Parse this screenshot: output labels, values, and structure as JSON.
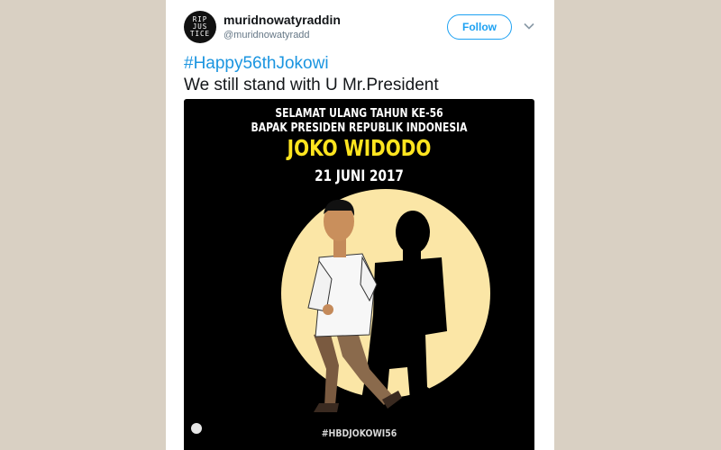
{
  "user": {
    "avatar_text": "RIP\nJUS\nTICE",
    "display_name": "muridnowatyraddin",
    "handle": "@muridnowatyradd"
  },
  "follow_label": "Follow",
  "tweet": {
    "hashtag": "#Happy56thJokowi",
    "text": "We still stand with U Mr.President"
  },
  "poster": {
    "line1": "SELAMAT ULANG TAHUN KE-56",
    "line2": "BAPAK PRESIDEN REPUBLIK INDONESIA",
    "name": "JOKO WIDODO",
    "date": "21 JUNI 2017",
    "hashtag": "#HBDJOKOWI56"
  },
  "icons": {
    "chevron": "chevron-down-icon",
    "gif": "media-badge-icon"
  },
  "colors": {
    "link": "#1b95e0",
    "follow": "#1da1f2",
    "poster_circle": "#fbe6a6",
    "poster_name": "#ffe51f"
  }
}
